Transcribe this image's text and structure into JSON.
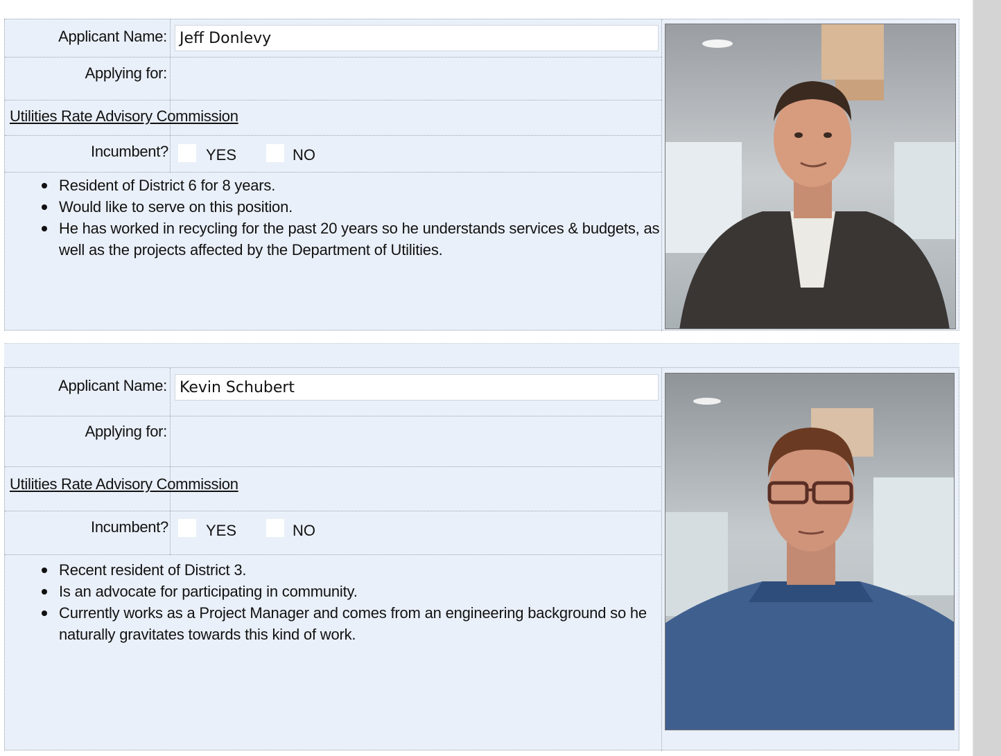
{
  "applicants": [
    {
      "name_label": "Applicant Name:",
      "name": "Jeff Donlevy",
      "applying_label": "Applying for:",
      "position": "Utilities Rate Advisory Commission",
      "incumbent_label": "Incumbent?",
      "yes_label": "YES",
      "no_label": "NO",
      "notes": [
        "Resident of District 6 for 8 years.",
        "Would like to serve on this position.",
        "He has worked in recycling for the past 20 years so he understands services & budgets, as well as the projects affected by the Department of Utilities."
      ]
    },
    {
      "name_label": "Applicant Name:",
      "name": "Kevin Schubert",
      "applying_label": "Applying for:",
      "position": "Utilities Rate Advisory Commission",
      "incumbent_label": "Incumbent?",
      "yes_label": "YES",
      "no_label": "NO",
      "notes": [
        "Recent resident of District 3.",
        "Is an advocate for participating in community.",
        "Currently works as a Project Manager and comes from an engineering background so he naturally gravitates towards this kind of work."
      ]
    }
  ]
}
